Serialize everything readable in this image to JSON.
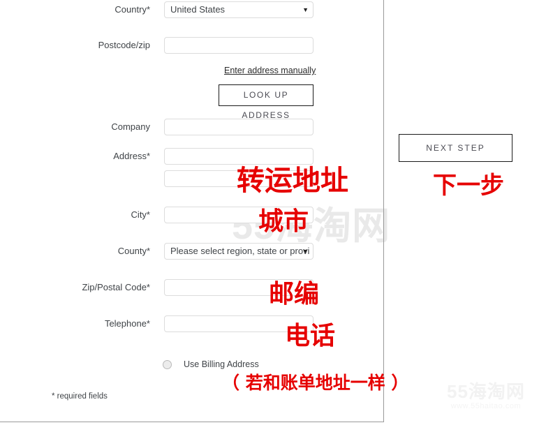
{
  "form": {
    "fields": [
      {
        "name": "country",
        "label": "Country*",
        "type": "select",
        "value": "United States"
      },
      {
        "name": "postcode",
        "label": "Postcode/zip",
        "type": "text",
        "value": ""
      },
      {
        "name": "company",
        "label": "Company",
        "type": "text",
        "value": ""
      },
      {
        "name": "address1",
        "label": "Address*",
        "type": "text",
        "value": ""
      },
      {
        "name": "address2",
        "label": "",
        "type": "text",
        "value": ""
      },
      {
        "name": "city",
        "label": "City*",
        "type": "text",
        "value": ""
      },
      {
        "name": "county",
        "label": "County*",
        "type": "select",
        "value": "Please select region, state or provi"
      },
      {
        "name": "zip",
        "label": "Zip/Postal Code*",
        "type": "text",
        "value": ""
      },
      {
        "name": "phone",
        "label": "Telephone*",
        "type": "text",
        "value": ""
      }
    ],
    "manual_link": "Enter address manually",
    "lookup_button": "LOOK UP ADDRESS",
    "radio_label": "Use Billing Address",
    "required_note": "* required fields",
    "caret_glyph": "▼"
  },
  "actions": {
    "next_step": "NEXT STEP"
  },
  "annotations": {
    "ship_address": "转运地址",
    "city": "城市",
    "zip": "邮编",
    "phone": "电话",
    "same_as_billing": "（ 若和账单地址一样 ）",
    "next_step": "下一步",
    "color": "#e60000"
  },
  "watermark": {
    "center": "55海淘网",
    "corner_main": "55海淘网",
    "corner_url": "www.55haitao.com"
  }
}
